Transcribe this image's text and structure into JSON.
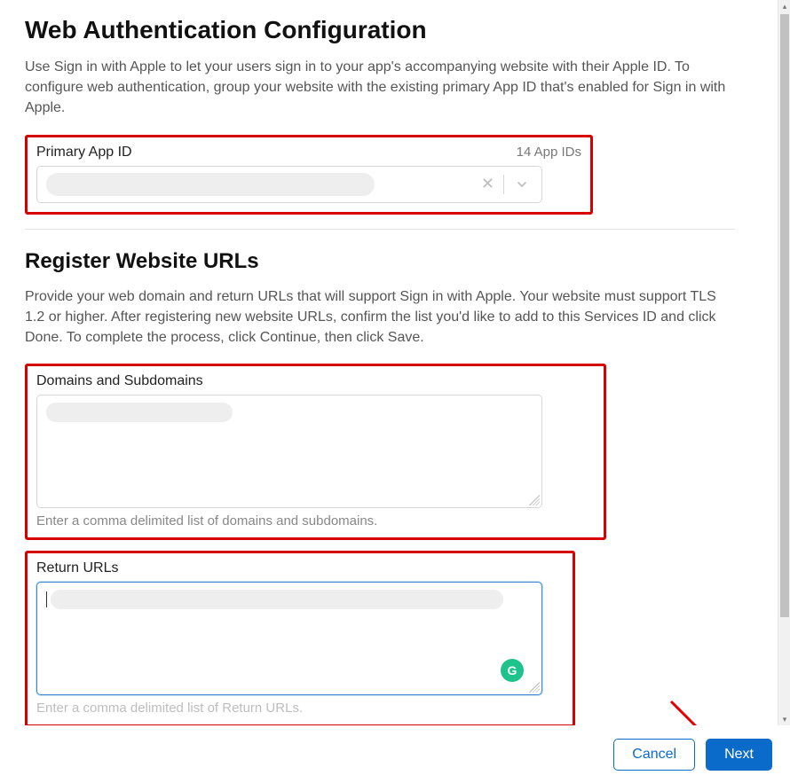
{
  "page": {
    "title": "Web Authentication Configuration",
    "intro": "Use Sign in with Apple to let your users sign in to your app's accompanying website with their Apple ID. To configure web authentication, group your website with the existing primary App ID that's enabled for Sign in with Apple."
  },
  "primaryApp": {
    "label": "Primary App ID",
    "count": "14 App IDs"
  },
  "registerSection": {
    "title": "Register Website URLs",
    "intro": "Provide your web domain and return URLs that will support Sign in with Apple. Your website must support TLS 1.2 or higher. After registering new website URLs, confirm the list you'd like to add to this Services ID and click Done. To complete the process, click Continue, then click Save."
  },
  "domains": {
    "label": "Domains and Subdomains",
    "help": "Enter a comma delimited list of domains and subdomains."
  },
  "returnUrls": {
    "label": "Return URLs",
    "help": "Enter a comma delimited list of Return URLs."
  },
  "footer": {
    "cancel": "Cancel",
    "next": "Next"
  },
  "icons": {
    "grammarly": "G"
  }
}
